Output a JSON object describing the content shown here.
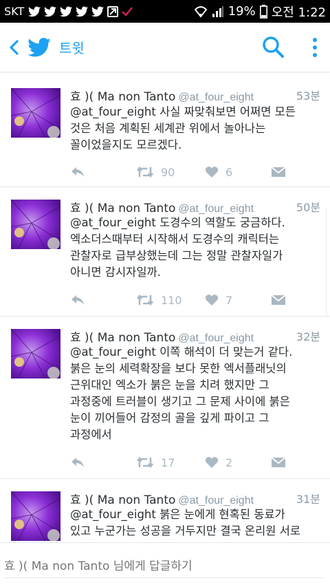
{
  "status_bar": {
    "carrier": "SKT",
    "battery": "19%",
    "time": "오전 1:22"
  },
  "app_bar": {
    "title": "트윗"
  },
  "tweets": [
    {
      "name": "효 )( Ma non Tanto",
      "handle": "@at_four_eight",
      "time": "53분",
      "text_lines": [
        "@at_four_eight 사실 짜맞춰보면 어쩌면 모든",
        "것은 처음 계획된 세계관 위에서 놀아나는",
        "꼴이었을지도 모르겠다."
      ],
      "retweets": "90",
      "likes": "6"
    },
    {
      "name": "효 )( Ma non Tanto",
      "handle": "@at_four_eight",
      "time": "50분",
      "text_lines": [
        "@at_four_eight 도경수의 역할도 궁금하다.",
        "엑소더스때부터 시작해서 도경수의 캐릭터는",
        "관찰자로 급부상했는데 그는 정말 관찰자일가",
        "아니면 감시자일까."
      ],
      "retweets": "110",
      "likes": "7"
    },
    {
      "name": "효 )( Ma non Tanto",
      "handle": "@at_four_eight",
      "time": "32분",
      "text_lines": [
        "@at_four_eight 이쪽 해석이 더 맞는거 같다.",
        "붉은 눈의 세력확장을 보다 못한 엑서플래닛의",
        "근위대인 엑소가 붉은 눈을 치려 했지만 그",
        "과정중에 트러블이 생기고 그 문제 사이에 붉은",
        "눈이 끼어들어 감정의 골을 깊게 파이고 그",
        "과정에서"
      ],
      "retweets": "17",
      "likes": "2"
    },
    {
      "name": "효 )( Ma non Tanto",
      "handle": "@at_four_eight",
      "time": "31분",
      "text_lines": [
        "@at_four_eight 붉은 눈에게 현혹된 동료가",
        "있고 누군가는 성공을 거두지만 결국 온리원 서로"
      ],
      "retweets": "",
      "likes": ""
    }
  ],
  "reply": {
    "placeholder": "효 )( Ma non Tanto 님에게 답글하기"
  },
  "colors": {
    "accent": "#1da1f2",
    "muted": "#aab8c2"
  },
  "icons": [
    "back-arrow-icon",
    "twitter-bird-icon",
    "search-icon",
    "more-vert-icon",
    "reply-icon",
    "retweet-icon",
    "heart-icon",
    "dm-envelope-icon"
  ]
}
